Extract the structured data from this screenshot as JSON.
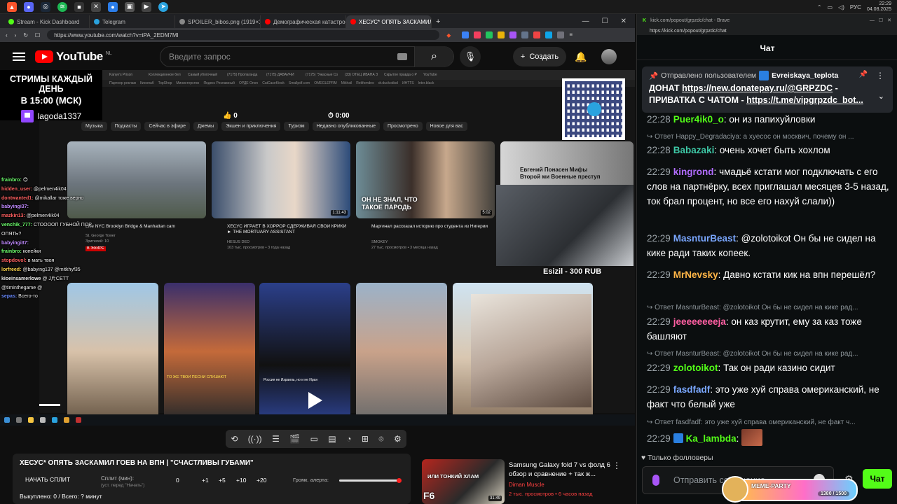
{
  "taskbar": {
    "lang": "РУС",
    "time": "22:29",
    "date": "04.08.2025"
  },
  "left_browser": {
    "tabs": [
      {
        "label": "Stream - Kick Dashboard",
        "color": "#53fc18"
      },
      {
        "label": "Telegram",
        "color": "#2aa3df"
      },
      {
        "label": "SPOILER_bibos.png (1919×1079)",
        "color": "#888888"
      },
      {
        "label": "Демографическая катастрофа. Що...",
        "color": "#ff0000"
      },
      {
        "label": "ХЕСУС* ОПЯТЬ ЗАСКАМИЛ Г...",
        "color": "#ff0000"
      }
    ],
    "url": "https://www.youtube.com/watch?v=tPA_2EDM7MI"
  },
  "youtube": {
    "logo": "YouTube",
    "region": "NL",
    "search_placeholder": "Введите запрос",
    "create_label": "Создать",
    "video_title": "ХЕСУС* ОПЯТЬ ЗАСКАМИЛ ГОЕВ НА ВПН | \"СЧАСТЛИВЫ ГУБАМИ\"",
    "recommended": {
      "title": "Samsung Galaxy fold 7 vs фолд 6 обзор и сравнение + так ж...",
      "channel": "Diman Muscle",
      "meta": "2 тыс. просмотров • 6 часов назад",
      "duration": "31:49",
      "thumb_text": "ИЛИ ТОНКИЙ ХЛАМ",
      "thumb_sub": "F6"
    }
  },
  "stream_overlay": {
    "schedule_line1": "СТРИМЫ КАЖДЫЙ ДЕНЬ",
    "schedule_line2": "В 15:00 (МСК)",
    "twitch_user": "lagoda1337",
    "donation": "Esizil - 300 RUB",
    "likes": "0",
    "time_display": "0:00",
    "inner_tabs": [
      "Kanye's Prison",
      "Коллекционное бел",
      "Самый убогочный",
      "(7175) Пропаганда",
      "(7175) ДАВАЙЧИ",
      "(7175) \"Ужасные Со",
      "(33) ОТЕЦ ИВАНА З",
      "Скрытое правда о Р",
      "YouTube"
    ],
    "inner_bookmarks": [
      "Партнер реклам",
      "Кинопаб",
      "TopShop",
      "Министерство",
      "Яндекс Рекламный",
      "ОРДЕ Onon",
      "CatCaseKiosk",
      "Smallpdf.com",
      "OMEGLEPRM",
      "Mikhail",
      "Rekfomdno",
      "dr.duckodisd",
      "ИНТТS",
      "Inter.black"
    ],
    "chips": [
      "Музыка",
      "Подкасты",
      "Сейчас в эфире",
      "Джемы",
      "Экшен и приключения",
      "Туризм",
      "Недавно опубликованные",
      "Просмотрено",
      "Новое для вас"
    ],
    "videos": [
      {
        "title": "Live NYC Brooklyn Bridge & Manhattan cam",
        "channel": "St. George Tower",
        "meta": "Зрителей: 10",
        "badge": "В ЭФИРЕ"
      },
      {
        "title": "ХЕСУС ИГРАЕТ В ХОРРОР СДЕРЖИВАЯ СВОИ КРИКИ ► THE MORTUARY ASSISTANT",
        "channel": "HESUS DED",
        "meta": "103 тыс. просмотров • 3 года назад",
        "duration": "1:11:43"
      },
      {
        "title": "Маргинал рассказал историю про студента из Нигерии",
        "channel": "SMOKEY",
        "meta": "27 тыс. просмотров • 3 месяца назад",
        "duration": "5:02",
        "thumb_text": "ОН НЕ ЗНАЛ, ЧТО ТАКОЕ ПАРОДЬ"
      },
      {
        "title": "Евгений Понасен Мифы Второй ми Военные преступ"
      }
    ],
    "thumb_captions": [
      "ТО ЖЕ ТВОИ ПЕСНИ СЛУШАЮТ",
      "Россия не Израиль, но и не Иран"
    ],
    "chat": [
      {
        "user": "frainbro:",
        "text": "😊",
        "color": "#6dff6d"
      },
      {
        "user": "hidden_user:",
        "text": "@pelmen4ik04",
        "color": "#ff6060"
      },
      {
        "user": "dontwanted1:",
        "text": "@mikallar тоже верно",
        "color": "#ff6060"
      },
      {
        "user": "babyingi37:",
        "text": "",
        "color": "#c08bff"
      },
      {
        "user": "mazkin13:",
        "text": "@pelmen4ik04",
        "color": "#ff6060"
      },
      {
        "user": "venchik_777:",
        "text": "СТООООП ГУБНОЙ ПОР",
        "color": "#6dff6d"
      },
      {
        "user": "",
        "text": "ОПЯТЬ?",
        "color": "#ffffff"
      },
      {
        "user": "babyingi37:",
        "text": "",
        "color": "#c08bff"
      },
      {
        "user": "frainbro:",
        "text": "копейки",
        "color": "#6dff6d"
      },
      {
        "user": "stopdovol:",
        "text": "в мать твоя",
        "color": "#ff6060"
      },
      {
        "user": "lorfreed:",
        "text": "@babying137 @mitkhyf35",
        "color": "#ffd84d"
      },
      {
        "user": "kioeinsamerlowe",
        "text": "@ J片CETT",
        "color": "#ffffff"
      },
      {
        "user": "",
        "text": "@timinthegame @",
        "color": "#ffffff"
      },
      {
        "user": "sepas:",
        "text": "Всего-то",
        "color": "#6a8bff"
      }
    ]
  },
  "controls": {
    "split_button": "НАЧАТЬ СПЛИТ",
    "split_label": "Сплит (мин):",
    "split_hint": "(уст. перед \"Начать\")",
    "split_value": "0",
    "steps": [
      "+1",
      "+5",
      "+10",
      "+20"
    ],
    "alert_label": "Громк. алерта:",
    "alert_volume": 0.97,
    "bought": "Выкуплено: 0 / Всего: ? минут"
  },
  "kick_chat": {
    "window_url": "kick.com/popout/grpzdc/chat - Brave",
    "url": "https://kick.com/popout/grpzdc/chat",
    "header": "Чат",
    "pinned_by_label": "Отправлено пользователем",
    "pinned_by_user": "Evreiskaya_teplota",
    "pinned_msg_1": "ДОНАТ ",
    "pinned_link_1": "https://new.donatepay.ru/@GRPZDC",
    "pinned_msg_2": " - ПРИВАТКА С ЧАТОМ - ",
    "pinned_link_2": "https://t.me/vipgrpzdc_bot...",
    "messages": [
      {
        "time": "22:28",
        "user": "Puer4ik0_o",
        "color": "#53fc18",
        "text": "он из папихуйловки"
      },
      {
        "reply": "Ответ Happy_Degradaciya: а хуесос он москвич, почему он ..."
      },
      {
        "time": "22:28",
        "user": "Babazaki",
        "color": "#3ec9a7",
        "text": "очень хочет быть хохлом"
      },
      {
        "time": "22:29",
        "user": "kingrond",
        "color": "#b16cff",
        "text": "чмадьё кстати мог подключать с его слов на партнёрку, всех приглашал месяцев 3-5 назад, ток брал процент, но все его нахуй слали))"
      },
      {
        "time": "22:29",
        "user": "MasnturBeast",
        "color": "#7aa7ff",
        "text": "@zolotoikot Он бы не сидел на кике ради таких копеек."
      },
      {
        "time": "22:29",
        "user": "MrNevsky",
        "color": "#ffb547",
        "text": "Давно кстати кик на впн перешёл?"
      },
      {
        "reply": "Ответ MasnturBeast: @zolotoikot Он бы не сидел на кике рад..."
      },
      {
        "time": "22:29",
        "user": "jeeeeeeeeja",
        "color": "#ff5fa2",
        "text": "он каз крутит, ему за каз тоже башляют"
      },
      {
        "reply": "Ответ MasnturBeast: @zolotoikot Он бы не сидел на кике рад..."
      },
      {
        "time": "22:29",
        "user": "zolotoikot",
        "color": "#53fc18",
        "text": "Так он ради казино сидит"
      },
      {
        "time": "22:29",
        "user": "fasdfadf",
        "color": "#7aa7ff",
        "text": "это уже хуй справа омериканский, не факт что белый уже"
      },
      {
        "reply": "Ответ fasdfadf: это уже хуй справа омериканский, не факт ч..."
      },
      {
        "time": "22:29",
        "user": "Ka_lambda",
        "color": "#53fc18",
        "text": ""
      }
    ],
    "followers_only": "Только фолловеры",
    "input_placeholder": "Отправить сообщение...",
    "send_label": "Чат",
    "meme_party_label": "MEME-PARTY",
    "meme_party_progress": "1380 / 1500"
  }
}
